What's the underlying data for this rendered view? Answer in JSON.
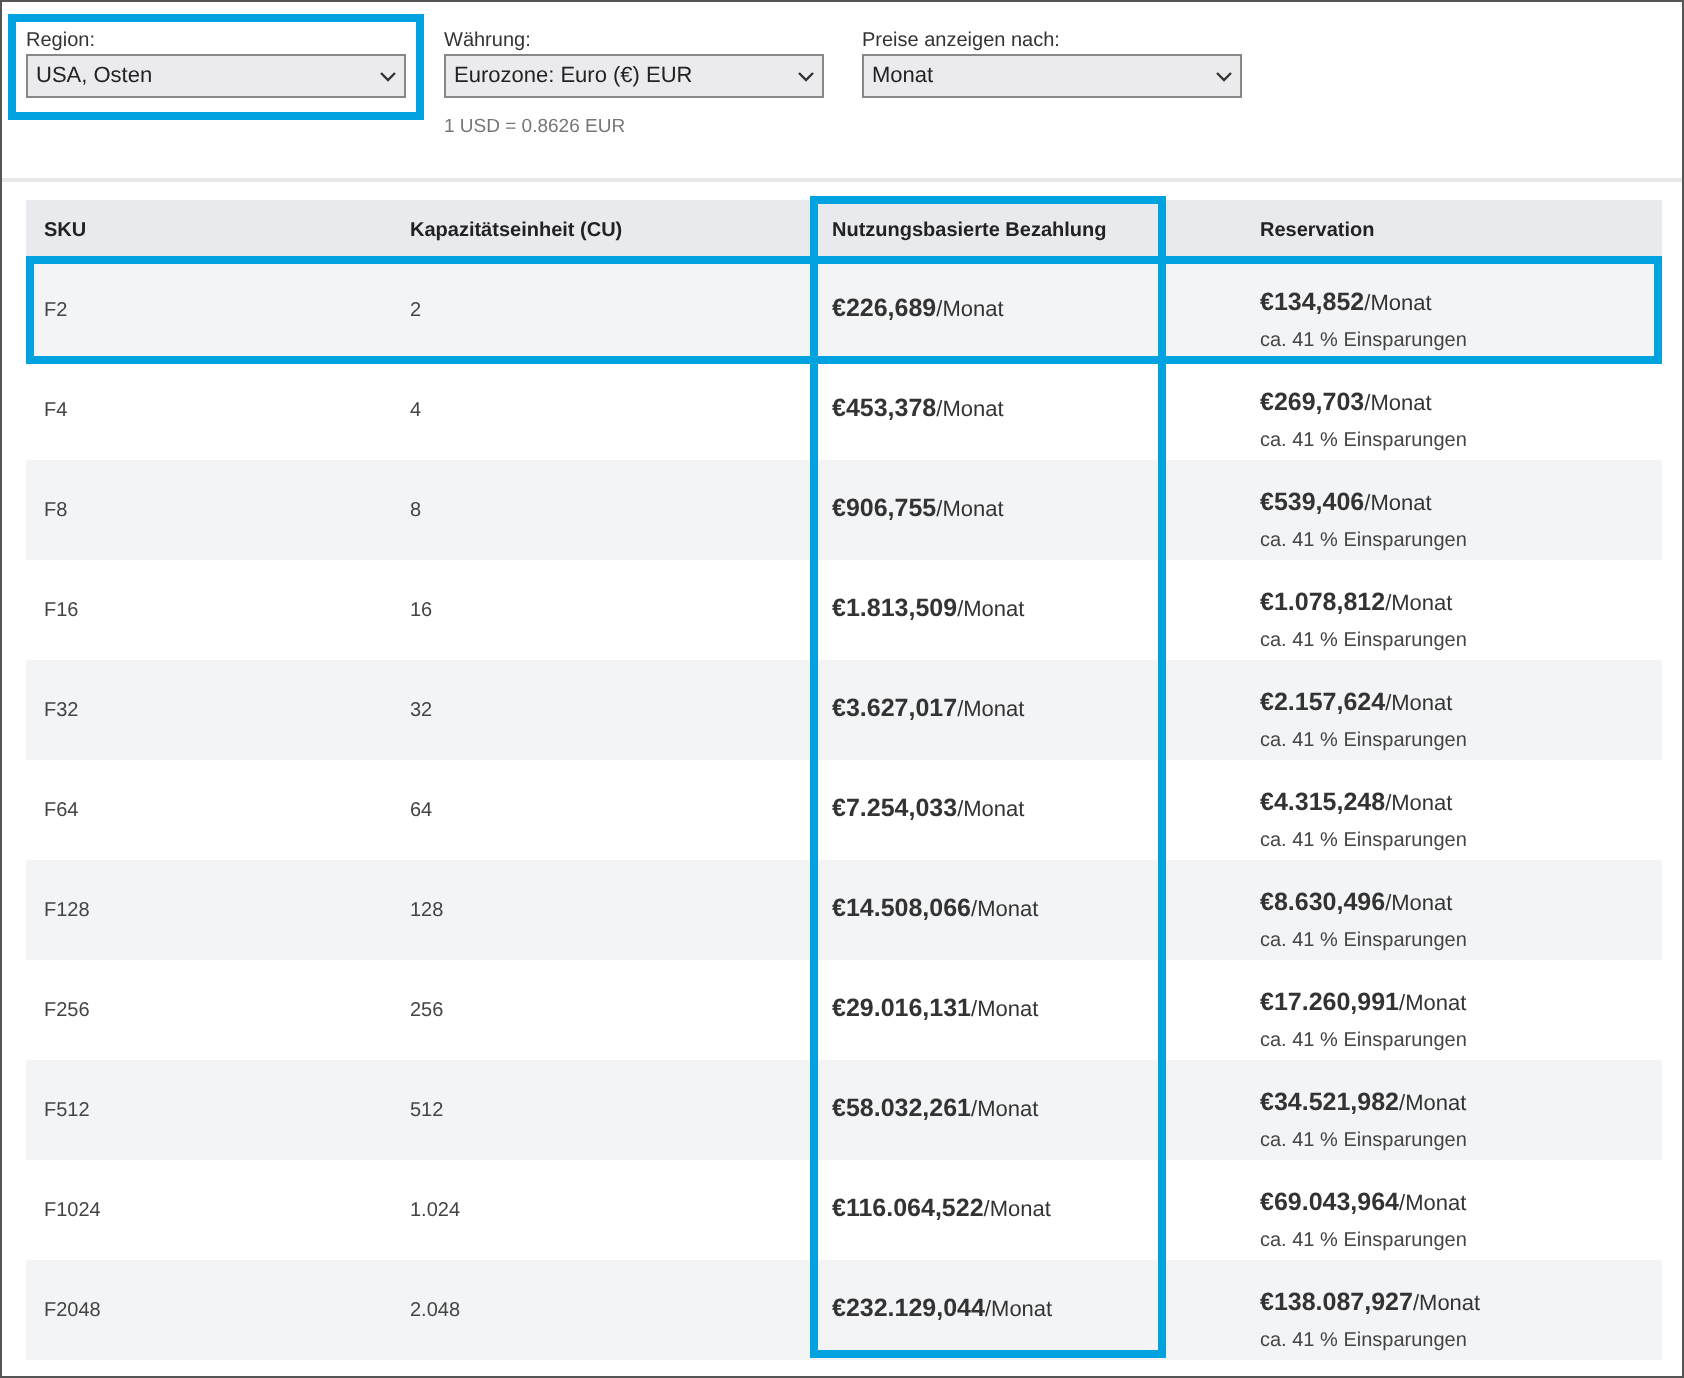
{
  "filters": [
    {
      "label": "Region:",
      "value": "USA, Osten",
      "highlighted": true
    },
    {
      "label": "Währung:",
      "value": "Eurozone: Euro (€) EUR",
      "highlighted": false,
      "note": "1 USD = 0.8626 EUR"
    },
    {
      "label": "Preise anzeigen nach:",
      "value": "Monat",
      "highlighted": false
    }
  ],
  "table": {
    "columns": [
      {
        "label": "SKU",
        "highlighted": false
      },
      {
        "label": "Kapazitätseinheit (CU)",
        "highlighted": false
      },
      {
        "label": "Nutzungsbasierte Bezahlung",
        "highlighted": true
      },
      {
        "label": "Reservation",
        "highlighted": false
      }
    ],
    "rows": [
      {
        "sku": "F2",
        "cu": "2",
        "payg": "**€226,689**/Monat",
        "reservation": "**€134,852**/Monat",
        "savings": "ca. 41 % Einsparungen",
        "highlighted": true
      },
      {
        "sku": "F4",
        "cu": "4",
        "payg": "**€453,378**/Monat",
        "reservation": "**€269,703**/Monat",
        "savings": "ca. 41 % Einsparungen",
        "highlighted": false
      },
      {
        "sku": "F8",
        "cu": "8",
        "payg": "**€906,755**/Monat",
        "reservation": "**€539,406**/Monat",
        "savings": "ca. 41 % Einsparungen",
        "highlighted": false
      },
      {
        "sku": "F16",
        "cu": "16",
        "payg": "**€1.813,509**/Monat",
        "reservation": "**€1.078,812**/Monat",
        "savings": "ca. 41 % Einsparungen",
        "highlighted": false
      },
      {
        "sku": "F32",
        "cu": "32",
        "payg": "**€3.627,017**/Monat",
        "reservation": "**€2.157,624**/Monat",
        "savings": "ca. 41 % Einsparungen",
        "highlighted": false
      },
      {
        "sku": "F64",
        "cu": "64",
        "payg": "**€7.254,033**/Monat",
        "reservation": "**€4.315,248**/Monat",
        "savings": "ca. 41 % Einsparungen",
        "highlighted": false
      },
      {
        "sku": "F128",
        "cu": "128",
        "payg": "**€14.508,066**/Monat",
        "reservation": "**€8.630,496**/Monat",
        "savings": "ca. 41 % Einsparungen",
        "highlighted": false
      },
      {
        "sku": "F256",
        "cu": "256",
        "payg": "**€29.016,131**/Monat",
        "reservation": "**€17.260,991**/Monat",
        "savings": "ca. 41 % Einsparungen",
        "highlighted": false
      },
      {
        "sku": "F512",
        "cu": "512",
        "payg": "**€58.032,261**/Monat",
        "reservation": "**€34.521,982**/Monat",
        "savings": "ca. 41 % Einsparungen",
        "highlighted": false
      },
      {
        "sku": "F1024",
        "cu": "1.024",
        "payg": "**€116.064,522**/Monat",
        "reservation": "**€69.043,964**/Monat",
        "savings": "ca. 41 % Einsparungen",
        "highlighted": false
      },
      {
        "sku": "F2048",
        "cu": "2.048",
        "payg": "**€232.129,044**/Monat",
        "reservation": "**€138.087,927**/Monat",
        "savings": "ca. 41 % Einsparungen",
        "highlighted": false
      }
    ]
  }
}
